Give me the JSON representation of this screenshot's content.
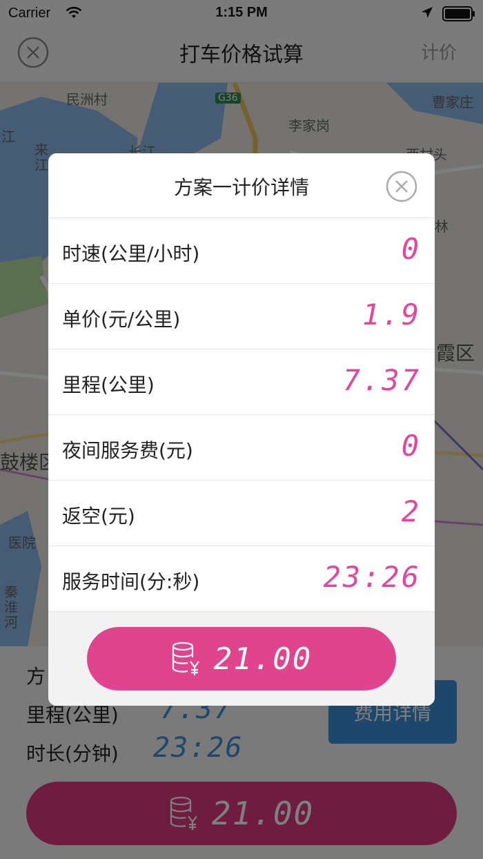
{
  "status_bar": {
    "carrier": "Carrier",
    "time": "1:15 PM"
  },
  "nav": {
    "title": "打车价格试算",
    "right_label": "计价"
  },
  "map": {
    "labels": [
      "民洲村",
      "G36",
      "曹家庄",
      "李家岗",
      "长江",
      "西村头",
      "来江",
      "江",
      "霞区",
      "林",
      "鼓楼区",
      "医院",
      "秦淮河"
    ]
  },
  "bottom_panel": {
    "plan_label": "方",
    "distance_label": "里程(公里)",
    "distance_value": "7.37",
    "duration_label": "时长(分钟)",
    "duration_value": "23:26",
    "detail_button": "费用详情",
    "total": "21.00"
  },
  "modal": {
    "title": "方案一计价详情",
    "rows": [
      {
        "label": "时速(公里/小时)",
        "value": "0"
      },
      {
        "label": "单价(元/公里)",
        "value": "1.9"
      },
      {
        "label": "里程(公里)",
        "value": "7.37"
      },
      {
        "label": "夜间服务费(元)",
        "value": "0"
      },
      {
        "label": "返空(元)",
        "value": "2"
      },
      {
        "label": "服务时间(分:秒)",
        "value": "23:26"
      }
    ],
    "total": "21.00"
  },
  "colors": {
    "accent_pink": "#e0448d",
    "accent_blue": "#3d8ed8",
    "value_pink": "#e0489a"
  }
}
